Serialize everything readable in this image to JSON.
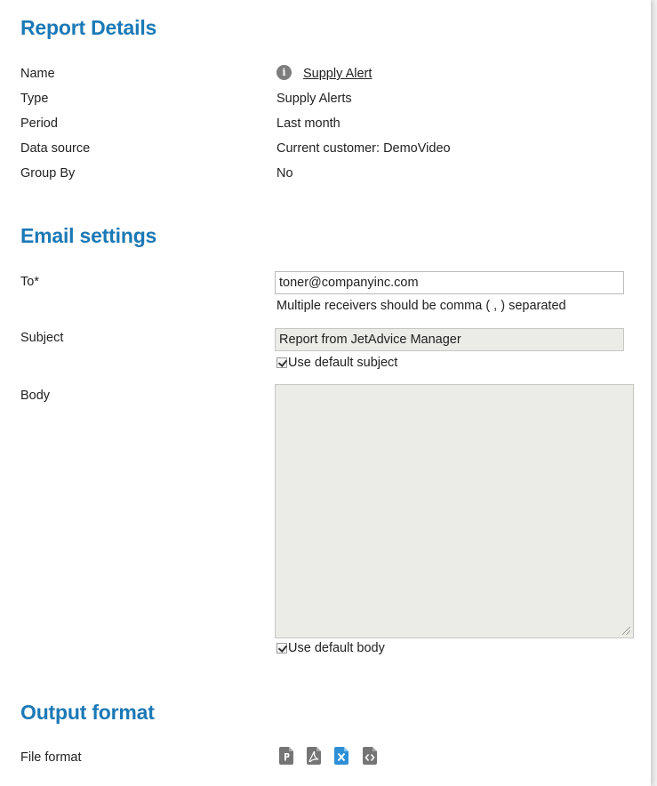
{
  "report_details": {
    "heading": "Report Details",
    "rows": {
      "name": {
        "label": "Name",
        "value": "Supply Alert"
      },
      "type": {
        "label": "Type",
        "value": "Supply Alerts"
      },
      "period": {
        "label": "Period",
        "value": "Last month"
      },
      "data_source": {
        "label": "Data source",
        "value": "Current customer: DemoVideo"
      },
      "group_by": {
        "label": "Group By",
        "value": "No"
      }
    },
    "info_icon_glyph": "i"
  },
  "email_settings": {
    "heading": "Email settings",
    "to": {
      "label": "To*",
      "value": "toner@companyinc.com",
      "hint": "Multiple receivers should be comma ( , ) separated"
    },
    "subject": {
      "label": "Subject",
      "value": "Report from JetAdvice Manager",
      "checkbox_label": "Use default subject",
      "checked": true
    },
    "body": {
      "label": "Body",
      "value": "",
      "checkbox_label": "Use default body",
      "checked": true
    }
  },
  "output_format": {
    "heading": "Output format",
    "file_format_label": "File format",
    "formats": [
      {
        "icon": "pptx-file-icon",
        "selected": false
      },
      {
        "icon": "pdf-file-icon",
        "selected": false
      },
      {
        "icon": "xlsx-file-icon",
        "selected": true
      },
      {
        "icon": "html-file-icon",
        "selected": false
      }
    ]
  },
  "colors": {
    "heading": "#1b79b6",
    "icon_default": "#757575",
    "icon_selected": "#2f8fd6"
  }
}
